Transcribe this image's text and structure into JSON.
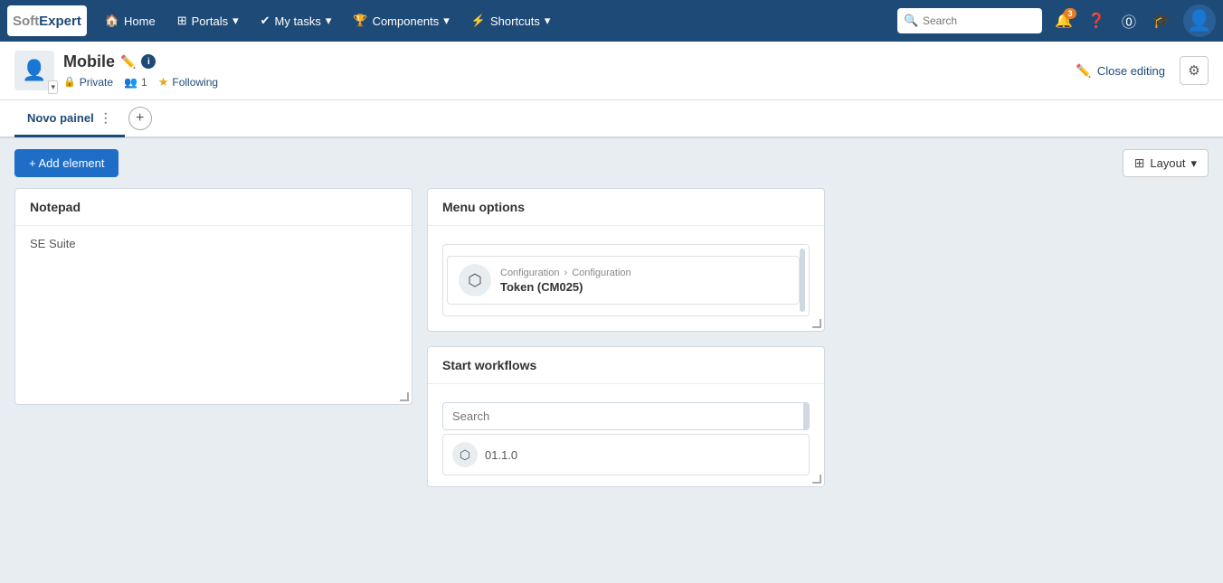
{
  "topnav": {
    "logo": "SoftExpert",
    "logo_soft": "Soft",
    "logo_expert": "Expert",
    "items": [
      {
        "label": "Home",
        "icon": "home"
      },
      {
        "label": "Portals",
        "icon": "grid",
        "has_arrow": true
      },
      {
        "label": "My tasks",
        "icon": "check",
        "has_arrow": true
      },
      {
        "label": "Components",
        "icon": "trophy",
        "has_arrow": true
      },
      {
        "label": "Shortcuts",
        "icon": "bolt",
        "has_arrow": true
      }
    ],
    "search_placeholder": "Search",
    "notification_badge": "3"
  },
  "header": {
    "title": "Mobile",
    "private_label": "Private",
    "members_count": "1",
    "following_label": "Following",
    "close_editing_label": "Close editing"
  },
  "tabs": {
    "items": [
      {
        "label": "Novo painel",
        "active": true
      }
    ],
    "add_label": "+"
  },
  "toolbar": {
    "add_element_label": "+ Add element",
    "layout_label": "Layout"
  },
  "notepad_card": {
    "title": "Notepad",
    "content": "SE Suite"
  },
  "menu_options_card": {
    "title": "Menu options",
    "items": [
      {
        "breadcrumb": "Configuration",
        "breadcrumb_sep": ">",
        "breadcrumb_end": "Configuration",
        "name": "Token (CM025)"
      }
    ]
  },
  "start_workflows_card": {
    "title": "Start workflows",
    "search_placeholder": "Search",
    "preview_text": "01.1.0"
  }
}
